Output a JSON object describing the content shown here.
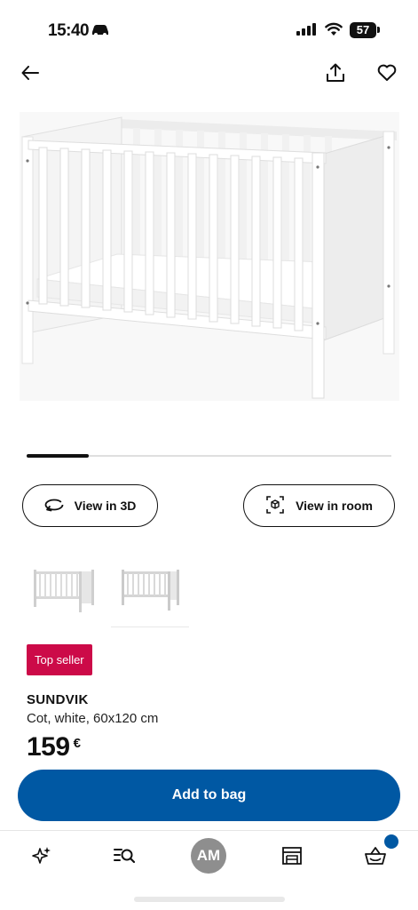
{
  "status_bar": {
    "time": "15:40",
    "battery": "57",
    "icons": [
      "car-icon",
      "signal-icon",
      "wifi-icon",
      "battery-icon"
    ]
  },
  "top_nav": {
    "icons": [
      "arrow-left-icon",
      "share-icon",
      "heart-icon"
    ]
  },
  "gallery": {
    "progress": 0.17
  },
  "actions": {
    "view_3d": "View in 3D",
    "view_room": "View in room"
  },
  "product": {
    "badge": "Top seller",
    "name": "SUNDVIK",
    "description": "Cot, white, 60x120 cm",
    "price": "159",
    "currency": "€"
  },
  "cta": {
    "add_to_bag": "Add to bag"
  },
  "tab_bar": {
    "avatar_initials": "AM",
    "icons": [
      "sparkle-icon",
      "search-list-icon",
      "avatar",
      "store-icon",
      "basket-icon"
    ]
  },
  "colors": {
    "brand_blue": "#0058a3",
    "badge_red": "#cc0a48",
    "text": "#111111"
  }
}
